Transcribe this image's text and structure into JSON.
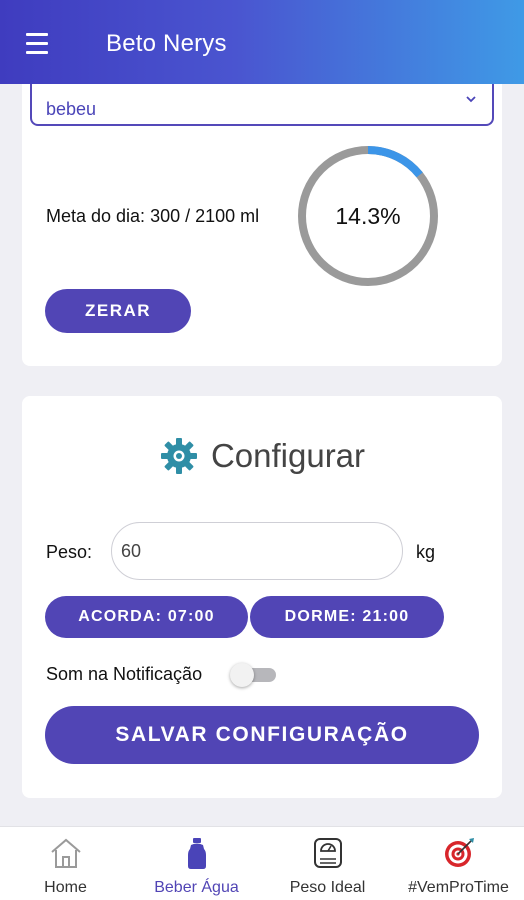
{
  "header": {
    "title": "Beto Nerys"
  },
  "drink": {
    "select_value": "bebeu",
    "meta_label": "Meta do dia: 300 / 2100 ml",
    "progress_text": "14.3%",
    "progress_fraction": 0.143,
    "reset_label": "ZERAR"
  },
  "config": {
    "title": "Configurar",
    "peso_label": "Peso:",
    "peso_value": "60",
    "peso_unit": "kg",
    "acorda_label": "ACORDA: 07:00",
    "dorme_label": "DORME: 21:00",
    "som_label": "Som na Notificação",
    "som_enabled": false,
    "save_label": "SALVAR CONFIGURAÇÃO"
  },
  "bottom_nav": {
    "items": [
      {
        "label": "Home",
        "icon": "home-icon",
        "active": false
      },
      {
        "label": "Beber Água",
        "icon": "water-bottle-icon",
        "active": true
      },
      {
        "label": "Peso Ideal",
        "icon": "scale-icon",
        "active": false
      },
      {
        "label": "#VemProTime",
        "icon": "target-icon",
        "active": false
      }
    ]
  },
  "colors": {
    "accent": "#5145b5",
    "progress": "#3c95e8",
    "ring_track": "#9a9a9a",
    "header_gradient_start": "#3f3cbf",
    "header_gradient_end": "#3f9ae6"
  }
}
